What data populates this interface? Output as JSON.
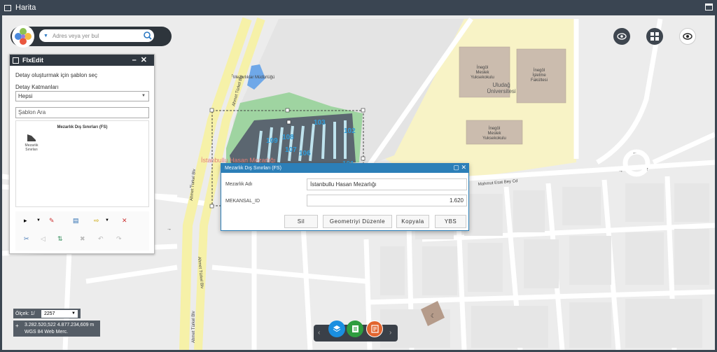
{
  "window": {
    "title": "Harita"
  },
  "search": {
    "placeholder": "Adres veya yer bul"
  },
  "flxedit": {
    "title": "FlxEdit",
    "minimize": "–",
    "close": "✕",
    "instruction": "Detay oluşturmak için şablon seç",
    "layers_label": "Detay Katmanları",
    "layers_value": "Hepsi",
    "template_search_placeholder": "Şablon Ara",
    "template_group_title": "Mezarlık Dış Sınırları (FS)",
    "template_item_label": "Mezarlık Sınırları"
  },
  "popup": {
    "title": "Mezarlık Dış Sınırları (FS)",
    "fields": [
      {
        "label": "Mezarlık Adı",
        "value": "İstanbullu Hasan Mezarlığı",
        "align": "left"
      },
      {
        "label": "MEKANSAL_ID",
        "value": "1.620",
        "align": "right"
      }
    ],
    "buttons": [
      "Sil",
      "Geometriyi Düzenle",
      "Kopyala",
      "YBS"
    ]
  },
  "map": {
    "labels": {
      "mudurlugu": "Mezarlıklar Müdürlüğü",
      "cemetery": "İstanbullu Hasan Mezarlığı",
      "uludag": "Uludağ",
      "universitesi": "Üniversitesi",
      "road_esat": "Mahmut Esat Bey Cd",
      "blvd": "Ahmet Türkel Blv",
      "b1_l1": "İnegöl",
      "b1_l2": "Meslek",
      "b1_l3": "Yuksekokulu",
      "b2_l1": "İnegöl",
      "b2_l2": "İşletme",
      "b2_l3": "Fakültesi",
      "b3_l1": "İnegöl",
      "b3_l2": "Meslek",
      "b3_l3": "Yuksekokulu",
      "parcels": [
        "103",
        "102",
        "109",
        "108",
        "107",
        "106",
        "101"
      ]
    }
  },
  "scale": {
    "label": "Ölçek: 1/",
    "value": "2257"
  },
  "coords": {
    "value": "3.282.520,522 4.877.234,609 m",
    "projection": "WGS 84 Web Merc."
  },
  "colors": {
    "cemetery_green": "#9fd4a1",
    "campus_yellow": "#f8f3c6",
    "building": "#cbbcae",
    "highway": "#f6f1a8",
    "accent_blue": "#2c7fb8"
  }
}
